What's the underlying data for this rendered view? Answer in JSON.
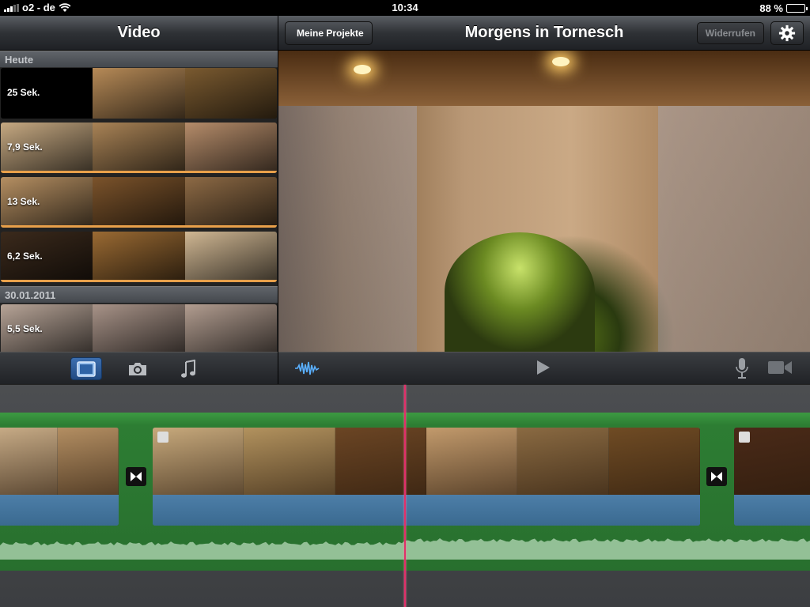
{
  "status": {
    "carrier": "o2 - de",
    "time": "10:34",
    "battery": "88 %",
    "battery_level": 0.88
  },
  "left_header": {
    "title": "Video"
  },
  "right_header": {
    "back_label": "Meine Projekte",
    "title": "Morgens in Tornesch",
    "undo_label": "Widerrufen"
  },
  "browser": {
    "sections": [
      {
        "title": "Heute",
        "clips": [
          {
            "duration": "25 Sek.",
            "colors": [
              "#000000",
              "#b68a57",
              "#7a5a30"
            ]
          },
          {
            "duration": "7,9 Sek.",
            "colors": [
              "#c6a982",
              "#a98356",
              "#b58c6a"
            ]
          },
          {
            "duration": "13 Sek.",
            "colors": [
              "#b58f62",
              "#7b532b",
              "#8d6a45"
            ]
          },
          {
            "duration": "6,2 Sek.",
            "colors": [
              "#3b2a1c",
              "#9a6a33",
              "#d0b793"
            ]
          }
        ]
      },
      {
        "title": "30.01.2011",
        "clips": [
          {
            "duration": "5,5 Sek.",
            "colors": [
              "#b7a497",
              "#a89388",
              "#b29d90"
            ]
          }
        ]
      }
    ]
  },
  "timeline": {
    "clips": [
      {
        "colors": [
          "#c7ab86",
          "#b38e62"
        ]
      },
      {
        "colors": [
          "#c7a97c",
          "#b2925e",
          "#6b4524",
          "#c29a6c",
          "#8a6a42",
          "#6f4b24"
        ]
      },
      {
        "colors": [
          "#4a2a18"
        ]
      }
    ]
  },
  "colors": {
    "playhead": "#e0306a",
    "project_green": "#2d7d33",
    "active_tab": "#2c5fa0"
  }
}
